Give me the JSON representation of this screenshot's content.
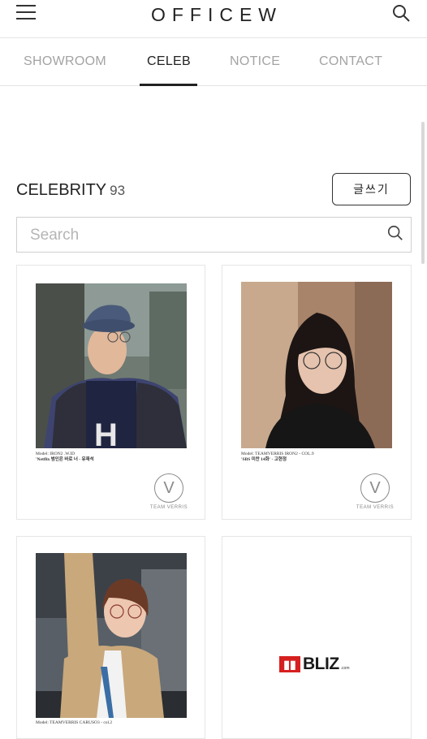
{
  "header": {
    "logo": "OFFICEW",
    "menu_icon": "hamburger-menu-icon",
    "search_icon": "search-icon"
  },
  "tabs": [
    {
      "label": "SHOWROOM",
      "active": false
    },
    {
      "label": "CELEB",
      "active": true
    },
    {
      "label": "NOTICE",
      "active": false
    },
    {
      "label": "CONTACT",
      "active": false
    }
  ],
  "section": {
    "title": "CELEBRITY",
    "count": "93",
    "write_button": "글쓰기"
  },
  "search": {
    "placeholder": "Search",
    "value": ""
  },
  "cards": [
    {
      "model": "Model: IRON2 .W.ID",
      "title": "'Netflix 범인은 바로 너 - 유재석",
      "brand": "TEAM VERRIS",
      "brand_letter": "V"
    },
    {
      "model": "Model: TEAMVERRIS IRON2 - COL.9",
      "title": "'SBS 미찬 14화' - 고현정",
      "brand": "TEAM VERRIS",
      "brand_letter": "V"
    },
    {
      "model": "Model: TEAMVERRIS CARUSO3 - col.2",
      "title": "",
      "brand": "",
      "brand_letter": ""
    },
    {
      "model": "",
      "title": "",
      "brand": "BLIZ",
      "brand_letter": "",
      "brand_sub": ".com"
    }
  ],
  "colors": {
    "accent": "#222222",
    "inactive_tab": "#a3a3a3",
    "bliz_red": "#d6201f"
  }
}
